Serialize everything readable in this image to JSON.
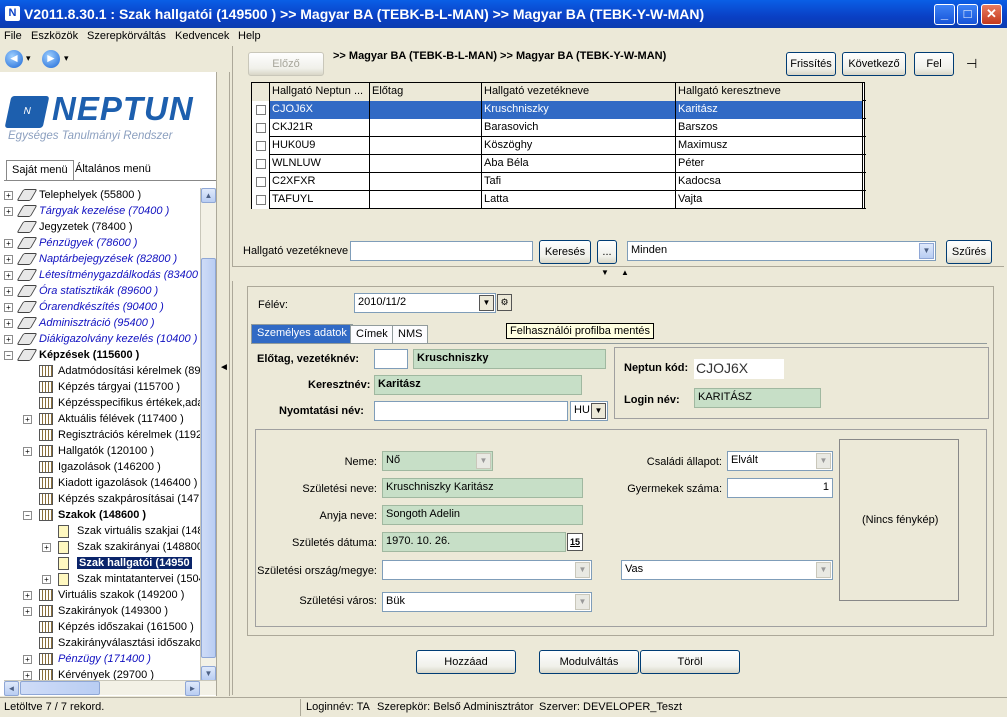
{
  "window": {
    "title": "V2011.8.30.1 : Szak hallgatói (149500 )  >> Magyar BA (TEBK-B-L-MAN) >> Magyar BA (TEBK-Y-W-MAN)",
    "app_icon": "N",
    "minimize": "_",
    "maximize": "□",
    "close": "✕"
  },
  "menu": [
    "File",
    "Eszközök",
    "Szerepkörváltás",
    "Kedvencek",
    "Help"
  ],
  "nav": {
    "back_arrow": "◄",
    "fwd_arrow": "►",
    "dropdown": "▾"
  },
  "logo": {
    "mark": "N",
    "name": "NEPTUN",
    "subtitle": "Egységes Tanulmányi Rendszer"
  },
  "menu_tabs": [
    "Saját menü",
    "Általános menü"
  ],
  "tree": [
    {
      "label": "Telephelyek (55800 )",
      "style": "normal",
      "indent": 0,
      "exp": "+",
      "icon": "tag"
    },
    {
      "label": "Tárgyak kezelése (70400 )",
      "style": "blue",
      "indent": 0,
      "exp": "+",
      "icon": "tag"
    },
    {
      "label": "Jegyzetek (78400 )",
      "style": "normal",
      "indent": 0,
      "exp": "",
      "icon": "tag"
    },
    {
      "label": "Pénzügyek (78600 )",
      "style": "blue",
      "indent": 0,
      "exp": "+",
      "icon": "tag"
    },
    {
      "label": "Naptárbejegyzések (82800 )",
      "style": "blue",
      "indent": 0,
      "exp": "+",
      "icon": "tag"
    },
    {
      "label": "Létesítménygazdálkodás (83400",
      "style": "blue",
      "indent": 0,
      "exp": "+",
      "icon": "tag"
    },
    {
      "label": "Óra statisztikák (89600 )",
      "style": "blue",
      "indent": 0,
      "exp": "+",
      "icon": "tag"
    },
    {
      "label": "Órarendkészítés (90400 )",
      "style": "blue",
      "indent": 0,
      "exp": "+",
      "icon": "tag"
    },
    {
      "label": "Adminisztráció (95400 )",
      "style": "blue",
      "indent": 0,
      "exp": "+",
      "icon": "tag"
    },
    {
      "label": "Diákigazolvány kezelés (10400 )",
      "style": "blue",
      "indent": 0,
      "exp": "+",
      "icon": "tag"
    },
    {
      "label": "Képzések (115600 )",
      "style": "bold",
      "indent": 0,
      "exp": "−",
      "icon": "tag"
    },
    {
      "label": "Adatmódosítási kérelmek (89",
      "style": "normal",
      "indent": 1,
      "exp": "",
      "icon": "book"
    },
    {
      "label": "Képzés tárgyai (115700 )",
      "style": "normal",
      "indent": 1,
      "exp": "",
      "icon": "book"
    },
    {
      "label": "Képzésspecifikus értékek,ada",
      "style": "normal",
      "indent": 1,
      "exp": "",
      "icon": "book"
    },
    {
      "label": "Aktuális félévek (117400 )",
      "style": "normal",
      "indent": 1,
      "exp": "+",
      "icon": "book"
    },
    {
      "label": "Regisztrációs kérelmek (1192",
      "style": "normal",
      "indent": 1,
      "exp": "",
      "icon": "book"
    },
    {
      "label": "Hallgatók (120100 )",
      "style": "normal",
      "indent": 1,
      "exp": "+",
      "icon": "book"
    },
    {
      "label": "Igazolások (146200 )",
      "style": "normal",
      "indent": 1,
      "exp": "",
      "icon": "book"
    },
    {
      "label": "Kiadott igazolások (146400 )",
      "style": "normal",
      "indent": 1,
      "exp": "",
      "icon": "book"
    },
    {
      "label": "Képzés szakpárosításai (1471",
      "style": "normal",
      "indent": 1,
      "exp": "",
      "icon": "book"
    },
    {
      "label": "Szakok (148600 )",
      "style": "bold",
      "indent": 1,
      "exp": "−",
      "icon": "book"
    },
    {
      "label": "Szak virtuális szakjai (148",
      "style": "normal",
      "indent": 2,
      "exp": "",
      "icon": "doc"
    },
    {
      "label": "Szak szakirányai (148800",
      "style": "normal",
      "indent": 2,
      "exp": "+",
      "icon": "doc"
    },
    {
      "label": "Szak hallgatói (14950",
      "style": "sel",
      "indent": 2,
      "exp": "",
      "icon": "doc"
    },
    {
      "label": "Szak mintatantervei (1504",
      "style": "normal",
      "indent": 2,
      "exp": "+",
      "icon": "doc"
    },
    {
      "label": "Virtuális szakok (149200 )",
      "style": "normal",
      "indent": 1,
      "exp": "+",
      "icon": "book"
    },
    {
      "label": "Szakirányok (149300 )",
      "style": "normal",
      "indent": 1,
      "exp": "+",
      "icon": "book"
    },
    {
      "label": "Képzés időszakai (161500 )",
      "style": "normal",
      "indent": 1,
      "exp": "",
      "icon": "book"
    },
    {
      "label": "Szakirányválasztási időszakol",
      "style": "normal",
      "indent": 1,
      "exp": "",
      "icon": "book"
    },
    {
      "label": "Pénzügy (171400 )",
      "style": "blue",
      "indent": 1,
      "exp": "+",
      "icon": "book"
    },
    {
      "label": "Kérvények (29700 )",
      "style": "normal",
      "indent": 1,
      "exp": "+",
      "icon": "book"
    }
  ],
  "scroll": {
    "up": "▲",
    "down": "▼",
    "left": "◄",
    "right": "►"
  },
  "splitter_arrow": "◄",
  "toolbar": {
    "prev": "Előző",
    "breadcrumb": ">> Magyar BA (TEBK-B-L-MAN) >> Magyar BA (TEBK-Y-W-MAN)",
    "refresh": "Frissítés",
    "next": "Következő",
    "up": "Fel",
    "pin": "⊣"
  },
  "grid": {
    "headers": [
      "Hallgató Neptun ...",
      "Előtag",
      "Hallgató vezetékneve",
      "Hallgató keresztneve"
    ],
    "rows": [
      [
        "CJOJ6X",
        "",
        "Kruschniszky",
        "Karitász"
      ],
      [
        "CKJ21R",
        "",
        "Barasovich",
        "Barszos"
      ],
      [
        "HUK0U9",
        "",
        "Köszöghy",
        "Maximusz"
      ],
      [
        "WLNLUW",
        "",
        "Aba Béla",
        "Péter"
      ],
      [
        "C2XFXR",
        "",
        "Tafi",
        "Kadocsa"
      ],
      [
        "TAFUYL",
        "",
        "Latta",
        "Vajta"
      ]
    ]
  },
  "search": {
    "label": "Hallgató vezetékneve",
    "value": "",
    "button": "Keresés",
    "ellipsis": "...",
    "filter_value": "Minden",
    "filter_button": "Szűrés"
  },
  "collapse_arrows": {
    "down": "▼",
    "up": "▲"
  },
  "form": {
    "semester_label": "Félév:",
    "semester_value": "2010/11/2",
    "tabs": [
      "Személyes adatok",
      "Címek",
      "NMS"
    ],
    "tooltip": "Felhasználói profilba mentés",
    "prefix_label": "Előtag, vezetéknév:",
    "prefix_value": "",
    "surname_value": "Kruschniszky",
    "firstname_label": "Keresztnév:",
    "firstname_value": "Karitász",
    "printname_label": "Nyomtatási név:",
    "printname_value": "",
    "lang_value": "HU",
    "neptun_label": "Neptun kód:",
    "neptun_value": "CJOJ6X",
    "login_label": "Login név:",
    "login_value": "KARITÁSZ",
    "gender_label": "Neme:",
    "gender_value": "Nő",
    "marital_label": "Családi állapot:",
    "marital_value": "Elvált",
    "birthname_label": "Születési neve:",
    "birthname_value": "Kruschniszky Karitász",
    "children_label": "Gyermekek száma:",
    "children_value": "1",
    "mother_label": "Anyja neve:",
    "mother_value": "Songoth Adelin",
    "birthdate_label": "Születés dátuma:",
    "birthdate_value": "1970. 10. 26.",
    "calendar_icon": "15",
    "birthcountry_label": "Születési ország/megye:",
    "birthcountry_value": "",
    "county_value": "Vas",
    "birthcity_label": "Születési város:",
    "birthcity_value": "Bük",
    "photo_text": "(Nincs fénykép)"
  },
  "actions": {
    "add": "Hozzáad",
    "switch": "Modulváltás",
    "delete": "Töröl"
  },
  "status": {
    "records": "Letöltve 7 / 7 rekord.",
    "login": "Loginnév: TA",
    "role": "Szerepkör: Belső Adminisztrátor",
    "server": "Szerver: DEVELOPER_Teszt"
  }
}
